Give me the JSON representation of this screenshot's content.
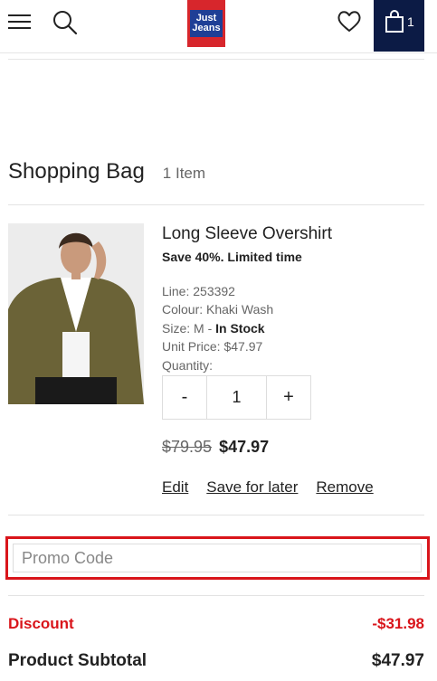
{
  "header": {
    "logo_line1": "Just",
    "logo_line2": "Jeans",
    "bag_count": "1",
    "colors": {
      "brand_red": "#d7262c",
      "brand_blue": "#1f3f96",
      "bag_bg": "#0c1b45"
    },
    "icons": [
      "hamburger-menu-icon",
      "search-icon",
      "heart-icon",
      "shopping-bag-icon"
    ]
  },
  "bag": {
    "title": "Shopping Bag",
    "item_count": "1 Item"
  },
  "product": {
    "name": "Long Sleeve Overshirt",
    "promo": "Save 40%. Limited time",
    "line": "Line: 253392",
    "colour": "Colour: Khaki Wash",
    "size_prefix": "Size: M - ",
    "stock": "In Stock",
    "unit_price": "Unit Price: $47.97",
    "quantity_label": "Quantity:",
    "quantity": "1",
    "decrement": "-",
    "increment": "+",
    "was_price": "$79.95",
    "now_price": "$47.97",
    "edit": "Edit",
    "save_for_later": "Save for later",
    "remove": "Remove"
  },
  "promo": {
    "placeholder": "Promo Code",
    "highlight_color": "#d9151b"
  },
  "summary": {
    "discount_label": "Discount",
    "discount_value": "-$31.98",
    "subtotal_label": "Product Subtotal",
    "subtotal_value": "$47.97"
  }
}
